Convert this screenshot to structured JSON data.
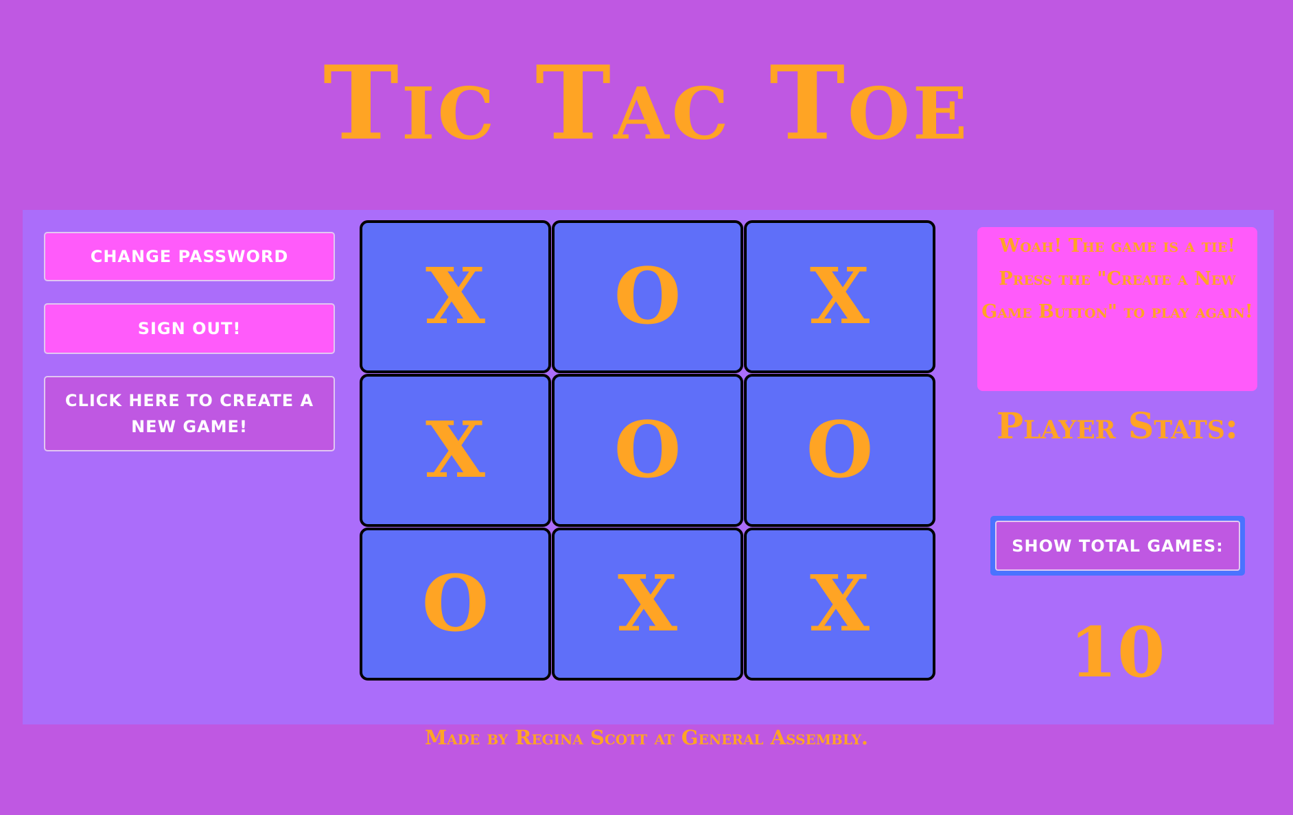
{
  "title": "Tic Tac Toe",
  "colors": {
    "background": "#bf58e2",
    "panel": "#ab6dfa",
    "accent": "#ffa424",
    "pink_button": "#ff5bfa",
    "cell": "#5f6ff9",
    "focus_ring": "#4a73ff"
  },
  "sidebar": {
    "change_password": "CHANGE PASSWORD",
    "sign_out": "SIGN OUT!",
    "new_game": "CLICK HERE TO CREATE A NEW GAME!"
  },
  "board": {
    "cells": [
      "X",
      "O",
      "X",
      "X",
      "O",
      "O",
      "O",
      "X",
      "X"
    ]
  },
  "status": {
    "message": "Woah! The game is a tie! Press the \"Create a New Game Button\" to play again!"
  },
  "stats": {
    "title": "Player Stats:",
    "show_total_button": "SHOW TOTAL GAMES:",
    "total_games": "10"
  },
  "footer": {
    "text": "Made by Regina Scott at General Assembly."
  }
}
